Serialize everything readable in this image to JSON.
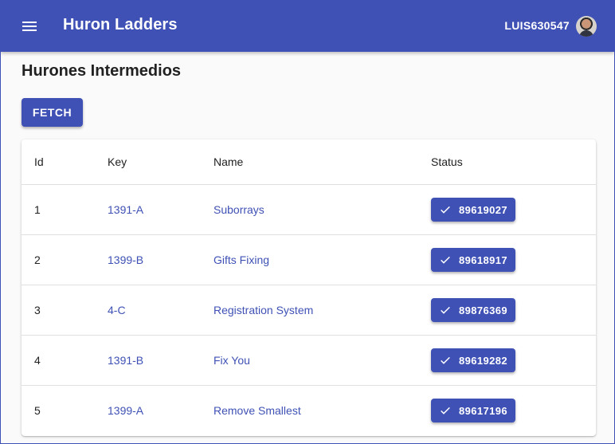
{
  "appbar": {
    "title": "Huron Ladders",
    "username": "LUIS630547",
    "menu_icon": "hamburger-menu-icon",
    "avatar_icon": "user-avatar"
  },
  "page": {
    "heading": "Hurones Intermedios",
    "fetch_label": "FETCH"
  },
  "table": {
    "headers": {
      "id": "Id",
      "key": "Key",
      "name": "Name",
      "status": "Status"
    },
    "rows": [
      {
        "id": "1",
        "key": "1391-A",
        "name": "Suborrays",
        "status": "89619027"
      },
      {
        "id": "2",
        "key": "1399-B",
        "name": "Gifts Fixing",
        "status": "89618917"
      },
      {
        "id": "3",
        "key": "4-C",
        "name": "Registration System",
        "status": "89876369"
      },
      {
        "id": "4",
        "key": "1391-B",
        "name": "Fix You",
        "status": "89619282"
      },
      {
        "id": "5",
        "key": "1399-A",
        "name": "Remove Smallest",
        "status": "89617196"
      }
    ]
  },
  "colors": {
    "primary": "#3f51b5",
    "background": "#fafafa",
    "text": "#212121"
  }
}
